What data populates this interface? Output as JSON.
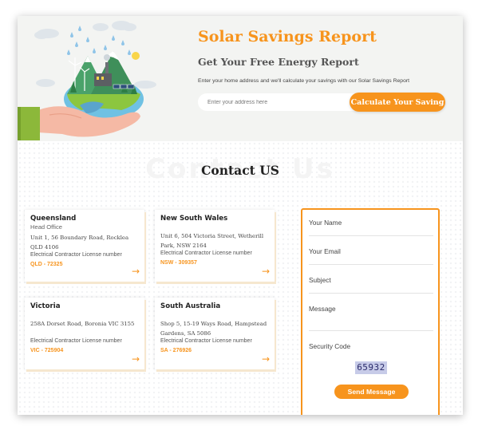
{
  "hero": {
    "title": "Solar Savings Report",
    "subtitle": "Get Your Free Energy Report",
    "description": "Enter your home address and we'll calculate your savings with our Solar Savings Report",
    "address_placeholder": "Enter your address here",
    "calculate_button": "Calculate Your Saving"
  },
  "contact": {
    "watermark": "Contact Us",
    "title": "Contact US",
    "offices": [
      {
        "name": "Queensland",
        "subtitle": "Head Office",
        "address": "Unit 1, 56 Boundary Road, Rocklea QLD 4106",
        "license_label": "Electrical Contractor License number",
        "license_number": "QLD - 72325"
      },
      {
        "name": "New South Wales",
        "subtitle": "",
        "address": "Unit 6, 504 Victoria Street, Wetherill Park, NSW 2164",
        "license_label": "Electrical Contractor License number",
        "license_number": "NSW - 309357"
      },
      {
        "name": "Victoria",
        "subtitle": "",
        "address": "258A Dorset Road, Boronia VIC 3155",
        "license_label": "Electrical Contractor License number",
        "license_number": "VIC - 725904"
      },
      {
        "name": "South Australia",
        "subtitle": "",
        "address": "Shop 5, 15-19 Ways Road, Hampstead Gardens, SA 5086",
        "license_label": "Electrical Contractor License number",
        "license_number": "SA - 276926"
      }
    ],
    "arrow_glyph": "→"
  },
  "form": {
    "name_label": "Your Name",
    "email_label": "Your Email",
    "subject_label": "Subject",
    "message_label": "Message",
    "security_label": "Security Code",
    "captcha_code": "65932",
    "send_button": "Send Message"
  },
  "colors": {
    "accent": "#f7941d",
    "hero_bg": "#f3f4f2",
    "text_dark": "#222222"
  },
  "icons": [
    "arrow-right-icon",
    "hand-holding-earth-illustration"
  ]
}
